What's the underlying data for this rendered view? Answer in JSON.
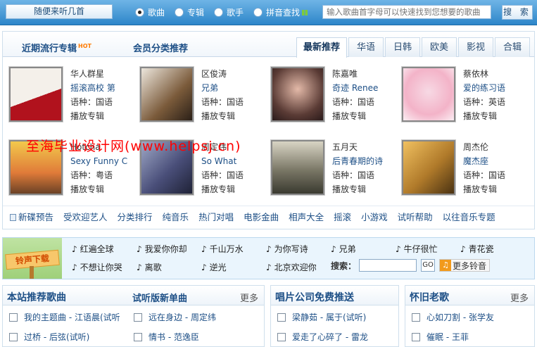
{
  "topbar": {
    "random_label": "随便来听几首",
    "radios": [
      {
        "label": "歌曲",
        "checked": true
      },
      {
        "label": "专辑",
        "checked": false
      },
      {
        "label": "歌手",
        "checked": false
      },
      {
        "label": "拼音查找",
        "checked": false
      }
    ],
    "search_placeholder": "输入歌曲首字母可以快速找到您想要的歌曲",
    "search_button": "搜 索"
  },
  "albums_panel": {
    "title_recent": "近期流行专辑",
    "hot_badge": "HOT",
    "title_member": "会员分类推荐",
    "tabs": [
      {
        "label": "最新推荐",
        "active": true
      },
      {
        "label": "华语",
        "active": false
      },
      {
        "label": "日韩",
        "active": false
      },
      {
        "label": "欧美",
        "active": false
      },
      {
        "label": "影视",
        "active": false
      },
      {
        "label": "合辑",
        "active": false
      }
    ],
    "albums": [
      {
        "artist": "华人群星",
        "title": "摇滚高校 第",
        "lang": "语种：国语",
        "play": "播放专辑"
      },
      {
        "artist": "区俊涛",
        "title": "兄弟",
        "lang": "语种：国语",
        "play": "播放专辑"
      },
      {
        "artist": "陈嘉唯",
        "title": "奇迹 Renee",
        "lang": "语种：国语",
        "play": "播放专辑"
      },
      {
        "artist": "蔡依林",
        "title": "爱的练习语",
        "lang": "语种：英语",
        "play": "播放专辑"
      },
      {
        "artist": "Hotcha",
        "title": "Sexy Funny C",
        "lang": "语种：粤语",
        "play": "播放专辑"
      },
      {
        "artist": "周定纬",
        "title": "So What",
        "lang": "语种：国语",
        "play": "播放专辑"
      },
      {
        "artist": "五月天",
        "title": "后青春期的诗",
        "lang": "语种：国语",
        "play": "播放专辑"
      },
      {
        "artist": "周杰伦",
        "title": "魔杰座",
        "lang": "语种：国语",
        "play": "播放专辑"
      }
    ],
    "watermark": "至海毕业设计网(www.helpsj.cn)",
    "categories": [
      "新碟预告",
      "受欢迎艺人",
      "分类排行",
      "纯音乐",
      "热门对唱",
      "电影金曲",
      "相声大全",
      "摇滚",
      "小游戏",
      "试听帮助",
      "以往音乐专题"
    ]
  },
  "ringtones": {
    "sign": "铃声下载",
    "songs": [
      "红遍全球",
      "我爱你你却",
      "千山万水",
      "为你写诗",
      "兄弟",
      "牛仔很忙",
      "青花瓷",
      "不想让你哭",
      "离歌",
      "逆光",
      "北京欢迎你"
    ],
    "search_label": "搜索：",
    "go_label": "GO",
    "more_label": "更多铃音"
  },
  "bottom": {
    "box1": {
      "title": "本站推荐歌曲",
      "subtitle": "试听版新单曲",
      "more": "更多",
      "left_items": [
        "我的主题曲 - 江语晨(试听",
        "过桥 - 后弦(试听)"
      ],
      "right_items": [
        "远在身边 - 周定纬",
        "情书 - 范逸臣"
      ]
    },
    "box2": {
      "title": "唱片公司免费推送",
      "items": [
        "梁静茹 - 属于(试听)",
        "爱走了心碎了 - 雷龙"
      ]
    },
    "box3": {
      "title": "怀旧老歌",
      "more": "更多",
      "items": [
        "心如刀割 - 张学友",
        "催眠 - 王菲"
      ]
    }
  }
}
